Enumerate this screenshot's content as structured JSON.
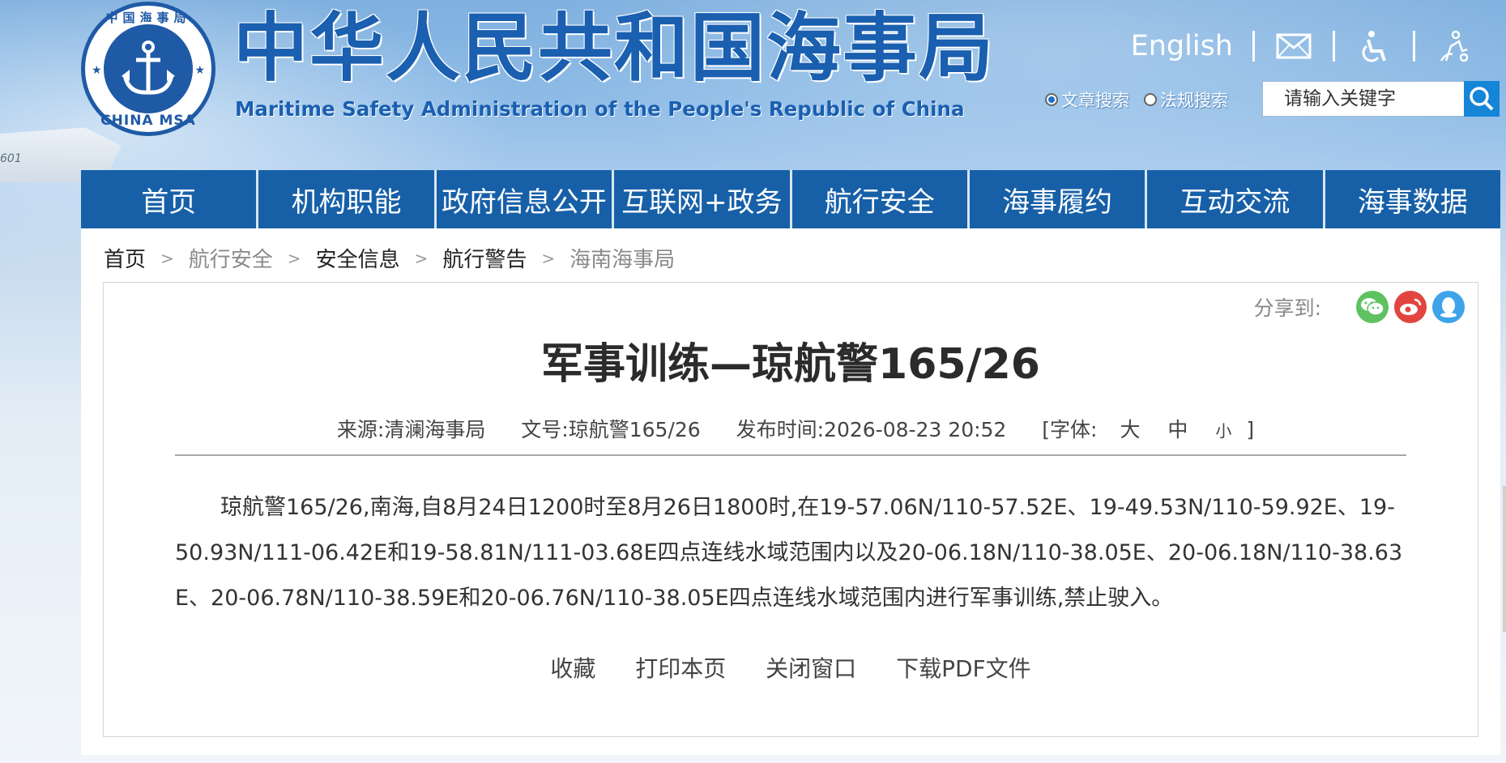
{
  "header": {
    "logo_top_text": "中国海事局",
    "logo_bottom_text": "CHINA MSA",
    "site_title": "中华人民共和国海事局",
    "site_subtitle": "Maritime Safety Administration of the People's Republic of China",
    "english_link": "English",
    "search": {
      "option_article": "文章搜索",
      "option_law": "法规搜索",
      "placeholder": "请输入关键字",
      "selected": "文章搜索"
    },
    "icons": [
      "mail-icon",
      "accessibility-icon",
      "elder-care-icon",
      "search-icon"
    ]
  },
  "nav": {
    "items": [
      "首页",
      "机构职能",
      "政府信息公开",
      "互联网+政务",
      "航行安全",
      "海事履约",
      "互动交流",
      "海事数据"
    ]
  },
  "breadcrumb": [
    "首页",
    "航行安全",
    "安全信息",
    "航行警告",
    "海南海事局"
  ],
  "share": {
    "label": "分享到:",
    "icons": [
      "wechat-icon",
      "weibo-icon",
      "qq-icon"
    ],
    "colors": {
      "wechat": "#5dc25f",
      "weibo": "#e2453f",
      "qq": "#3fa3ea"
    }
  },
  "article": {
    "title": "军事训练—琼航警165/26",
    "meta": {
      "source": "来源:清澜海事局",
      "doc_no": "文号:琼航警165/26",
      "publish_time": "发布时间:2026-08-23 20:52",
      "font_label": "[字体:",
      "font_large": "大",
      "font_medium": "中",
      "font_small": "小",
      "font_close": "]"
    },
    "body": "琼航警165/26,南海,自8月24日1200时至8月26日1800时,在19-57.06N/110-57.52E、19-49.53N/110-59.92E、19-50.93N/111-06.42E和19-58.81N/111-03.68E四点连线水域范围内以及20-06.18N/110-38.05E、20-06.18N/110-38.63E、20-06.78N/110-38.59E和20-06.76N/110-38.05E四点连线水域范围内进行军事训练,禁止驶入。",
    "actions": [
      "收藏",
      "打印本页",
      "关闭窗口",
      "下载PDF文件"
    ]
  },
  "colors": {
    "nav_bg": "#1760a8",
    "brand_blue": "#1a5fb0",
    "search_button": "#1585d8"
  }
}
